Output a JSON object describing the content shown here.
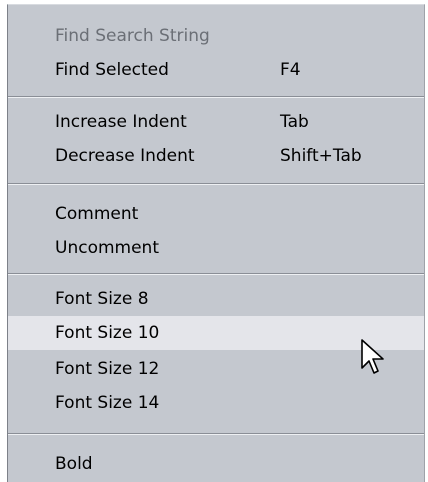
{
  "menu": {
    "items": [
      {
        "label": "Find Search String",
        "shortcut": "",
        "state": "disabled"
      },
      {
        "label": "Find Selected",
        "shortcut": "F4",
        "state": "normal"
      },
      {
        "label": "Increase Indent",
        "shortcut": "Tab",
        "state": "normal"
      },
      {
        "label": "Decrease Indent",
        "shortcut": "Shift+Tab",
        "state": "normal"
      },
      {
        "label": "Comment",
        "shortcut": "",
        "state": "normal"
      },
      {
        "label": "Uncomment",
        "shortcut": "",
        "state": "normal"
      },
      {
        "label": "Font Size 8",
        "shortcut": "",
        "state": "normal"
      },
      {
        "label": "Font Size 10",
        "shortcut": "",
        "state": "highlighted"
      },
      {
        "label": "Font Size 12",
        "shortcut": "",
        "state": "normal"
      },
      {
        "label": "Font Size 14",
        "shortcut": "",
        "state": "normal"
      },
      {
        "label": "Bold",
        "shortcut": "",
        "state": "normal"
      }
    ]
  },
  "colors": {
    "menu_background": "#c4c8cf",
    "highlight_background": "#e4e5ea",
    "text": "#000000",
    "disabled_text": "#6b6f76",
    "separator": "#8a8e96"
  },
  "cursor": {
    "icon": "mouse-pointer-icon"
  }
}
